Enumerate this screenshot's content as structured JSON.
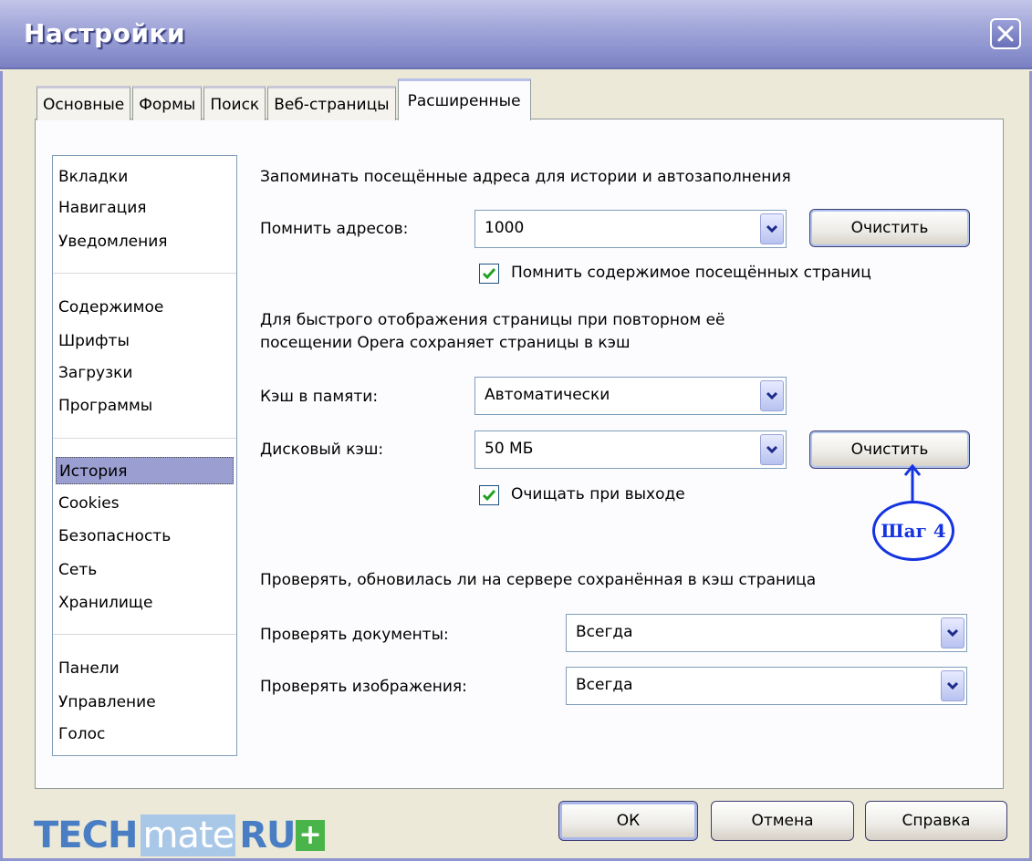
{
  "window": {
    "title": "Настройки"
  },
  "tabs": [
    {
      "label": "Основные"
    },
    {
      "label": "Формы"
    },
    {
      "label": "Поиск"
    },
    {
      "label": "Веб-страницы"
    },
    {
      "label": "Расширенные",
      "active": true
    }
  ],
  "nav": {
    "items": [
      {
        "label": "Вкладки"
      },
      {
        "label": "Навигация"
      },
      {
        "label": "Уведомления"
      },
      {
        "label": "Содержимое"
      },
      {
        "label": "Шрифты"
      },
      {
        "label": "Загрузки"
      },
      {
        "label": "Программы"
      },
      {
        "label": "История",
        "selected": true
      },
      {
        "label": "Cookies"
      },
      {
        "label": "Безопасность"
      },
      {
        "label": "Сеть"
      },
      {
        "label": "Хранилище"
      },
      {
        "label": "Панели"
      },
      {
        "label": "Управление"
      },
      {
        "label": "Голос"
      }
    ]
  },
  "history": {
    "heading": "Запоминать посещённые адреса для истории и автозаполнения",
    "remember_label": "Помнить адресов:",
    "remember_value": "1000",
    "clear_label": "Очистить",
    "remember_content_label": "Помнить содержимое посещённых страниц",
    "remember_content_checked": true
  },
  "cache": {
    "description_line1": "Для быстрого отображения страницы при повторном её",
    "description_line2": "посещении Opera сохраняет страницы в кэш",
    "memory_label": "Кэш в памяти:",
    "memory_value": "Автоматически",
    "disk_label": "Дисковый кэш:",
    "disk_value": "50 МБ",
    "clear_label": "Очистить",
    "clear_on_exit_label": "Очищать при выходе",
    "clear_on_exit_checked": true
  },
  "annotation": {
    "label": "Шаг 4"
  },
  "check": {
    "heading": "Проверять, обновилась ли на сервере сохранённая в кэш страница",
    "documents_label": "Проверять документы:",
    "documents_value": "Всегда",
    "images_label": "Проверять изображения:",
    "images_value": "Всегда"
  },
  "footer": {
    "ok_label": "ОК",
    "cancel_label": "Отмена",
    "help_label": "Справка"
  },
  "logo": {
    "part1": "TECH",
    "part2": "mate",
    "part3": "RU",
    "part4": "+"
  },
  "colors": {
    "accent": "#9a9ed0",
    "annotation": "#1533e0",
    "titlebar": "#8f95cf"
  }
}
